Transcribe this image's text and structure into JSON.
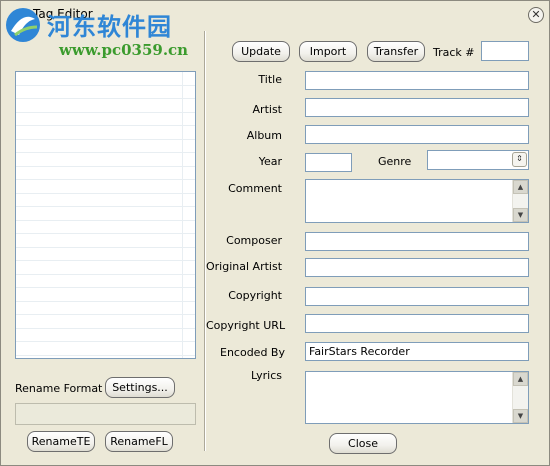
{
  "window": {
    "title": "Tag Editor",
    "close_glyph": "✕"
  },
  "watermark": {
    "name": "河东软件园",
    "url": "www.pc0359.cn"
  },
  "left_panel": {
    "rename_format_label": "Rename Format",
    "settings_button": "Settings...",
    "rename_format_value": "",
    "rename_te_button": "RenameTE",
    "rename_fl_button": "RenameFL"
  },
  "toolbar": {
    "update_button": "Update",
    "import_button": "Import",
    "transfer_button": "Transfer",
    "track_label": "Track #",
    "track_value": ""
  },
  "fields": {
    "title_label": "Title",
    "title_value": "",
    "artist_label": "Artist",
    "artist_value": "",
    "album_label": "Album",
    "album_value": "",
    "year_label": "Year",
    "year_value": "",
    "genre_label": "Genre",
    "genre_value": "",
    "comment_label": "Comment",
    "comment_value": "",
    "composer_label": "Composer",
    "composer_value": "",
    "original_artist_label": "Original Artist",
    "original_artist_value": "",
    "copyright_label": "Copyright",
    "copyright_value": "",
    "copyright_url_label": "Copyright URL",
    "copyright_url_value": "",
    "encoded_by_label": "Encoded By",
    "encoded_by_value": "FairStars Recorder",
    "lyrics_label": "Lyrics",
    "lyrics_value": ""
  },
  "footer": {
    "close_button": "Close"
  },
  "icons": {
    "scroll_up": "▲",
    "scroll_down": "▼",
    "combo": "⇕"
  },
  "colors": {
    "window_bg": "#ece9d8",
    "field_border": "#7f9db9",
    "watermark_blue": "#2f86d6",
    "watermark_green": "#3b9b2d"
  }
}
